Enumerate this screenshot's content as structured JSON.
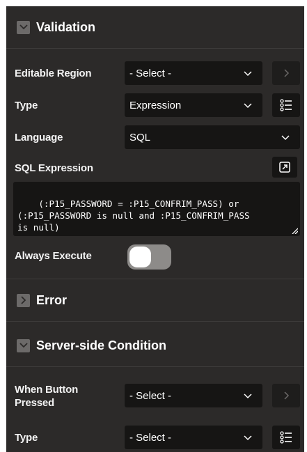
{
  "validation_section": {
    "title": "Validation",
    "editable_region": {
      "label": "Editable Region",
      "value": "- Select -"
    },
    "type": {
      "label": "Type",
      "value": "Expression"
    },
    "language": {
      "label": "Language",
      "value": "SQL"
    },
    "sql_expression": {
      "label": "SQL Expression",
      "value": "(:P15_PASSWORD = :P15_CONFRIM_PASS) or\n(:P15_PASSWORD is null and :P15_CONFRIM_PASS\nis null)"
    },
    "always_execute": {
      "label": "Always Execute",
      "on": false
    }
  },
  "error_section": {
    "title": "Error",
    "collapsed": true
  },
  "server_side_condition": {
    "title": "Server-side Condition",
    "when_button_pressed": {
      "label_line1": "When Button",
      "label_line2": "Pressed",
      "value": "- Select -"
    },
    "type": {
      "label": "Type",
      "value": "- Select -"
    }
  },
  "colors": {
    "panel": "#2c2a29",
    "field": "#161514",
    "icon_bg": "#6c6a69",
    "toggle_track": "#8d8b89"
  },
  "icons": {
    "section_expanded": "chevron-down-icon",
    "section_collapsed": "chevron-right-icon",
    "select": "chevron-down-icon",
    "lov": "chevron-right-icon",
    "type_help": "list-icon",
    "expand_editor": "expand-icon"
  }
}
